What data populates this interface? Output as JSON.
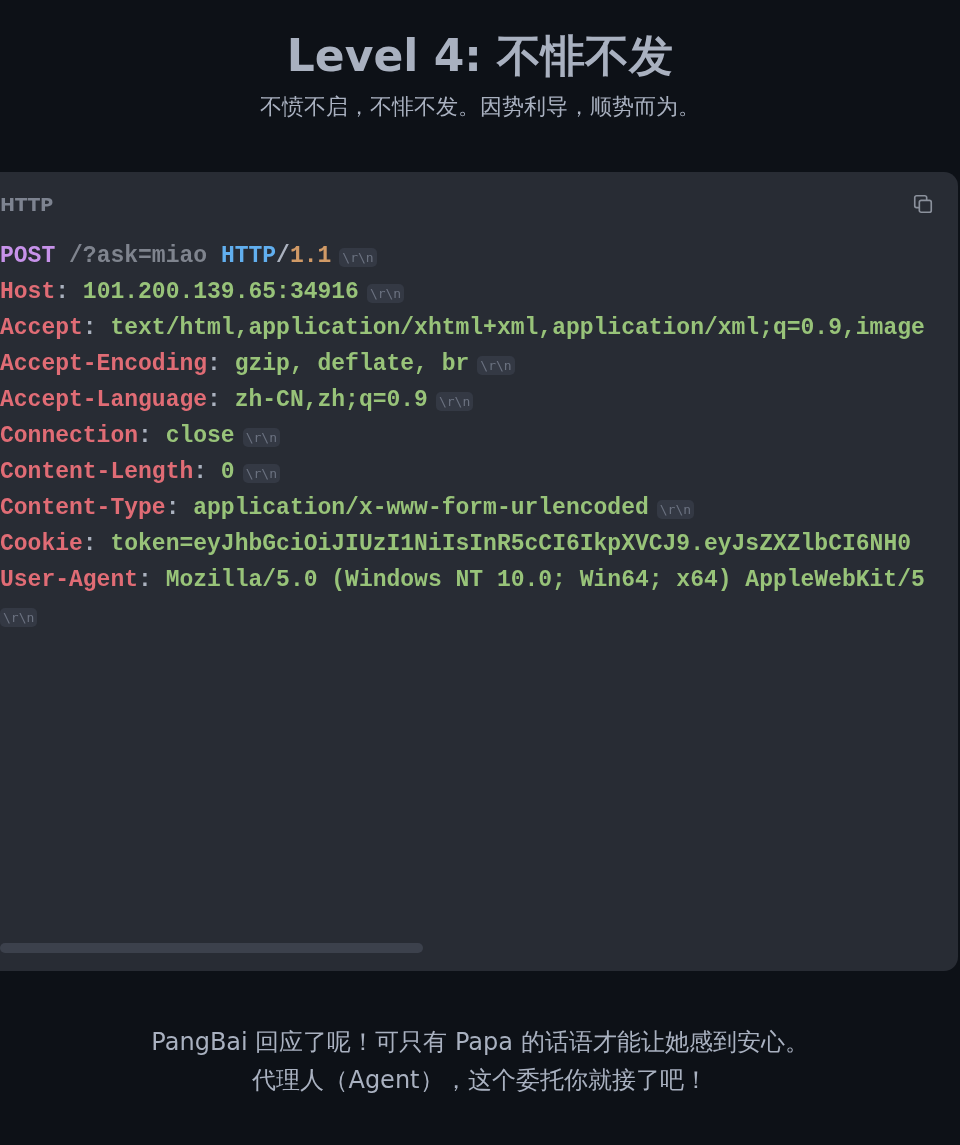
{
  "title": "Level 4: 不悱不发",
  "subtitle": "不愤不启，不悱不发。因势利导，顺势而为。",
  "code_block": {
    "language": "HTTP",
    "lines": [
      {
        "kind": "request",
        "method": "POST",
        "path": "/?ask=miao",
        "protocol": "HTTP",
        "separator": "/",
        "version": "1.1",
        "terminator": "\\r\\n"
      },
      {
        "kind": "header",
        "name": "Host",
        "separator": ":",
        "value": "101.200.139.65:34916",
        "terminator": "\\r\\n"
      },
      {
        "kind": "header",
        "name": "Accept",
        "separator": ":",
        "value": "text/html,application/xhtml+xml,application/xml;q=0.9,image"
      },
      {
        "kind": "header",
        "name": "Accept-Encoding",
        "separator": ":",
        "value": "gzip, deflate, br",
        "terminator": "\\r\\n"
      },
      {
        "kind": "header",
        "name": "Accept-Language",
        "separator": ":",
        "value": "zh-CN,zh;q=0.9",
        "terminator": "\\r\\n"
      },
      {
        "kind": "header",
        "name": "Connection",
        "separator": ":",
        "value": "close",
        "terminator": "\\r\\n"
      },
      {
        "kind": "header",
        "name": "Content-Length",
        "separator": ":",
        "value": "0",
        "terminator": "\\r\\n"
      },
      {
        "kind": "header",
        "name": "Content-Type",
        "separator": ":",
        "value": "application/x-www-form-urlencoded",
        "terminator": "\\r\\n"
      },
      {
        "kind": "header",
        "name": "Cookie",
        "separator": ":",
        "value": "token=eyJhbGciOiJIUzI1NiIsInR5cCI6IkpXVCJ9.eyJsZXZlbCI6NH0"
      },
      {
        "kind": "header",
        "name": "User-Agent",
        "separator": ":",
        "value": "Mozilla/5.0 (Windows NT 10.0; Win64; x64) AppleWebKit/5"
      },
      {
        "kind": "blank",
        "terminator": "\\r\\n"
      }
    ]
  },
  "footer": [
    "PangBai 回应了呢！可只有 Papa 的话语才能让她感到安心。",
    "代理人（Agent），这个委托你就接了吧！"
  ]
}
